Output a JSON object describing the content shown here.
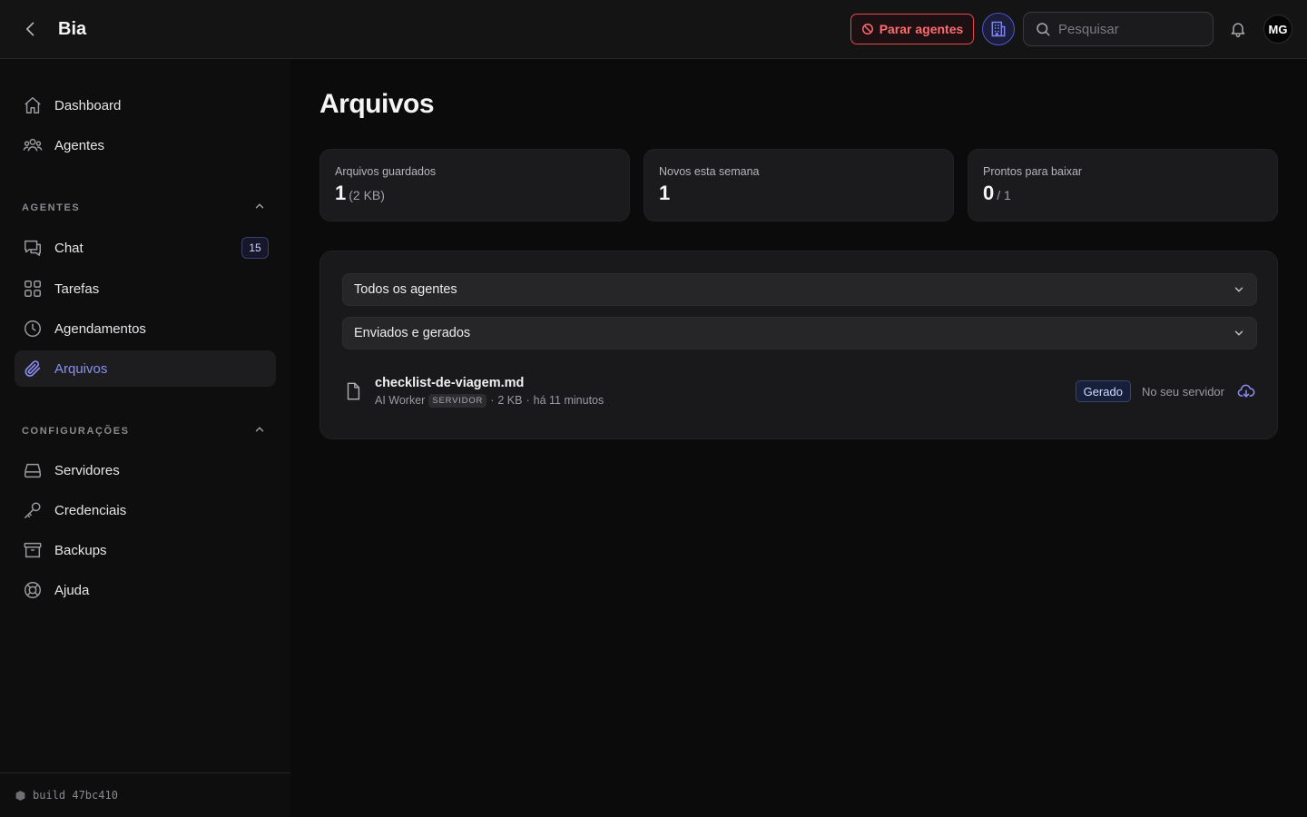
{
  "header": {
    "title": "Bia",
    "stop_label": "Parar agentes",
    "search_placeholder": "Pesquisar",
    "avatar_initials": "MG"
  },
  "sidebar": {
    "top_items": [
      {
        "label": "Dashboard",
        "icon": "home-icon"
      },
      {
        "label": "Agentes",
        "icon": "users-icon"
      }
    ],
    "sections": [
      {
        "title": "AGENTES",
        "items": [
          {
            "label": "Chat",
            "icon": "chat-icon",
            "badge": "15"
          },
          {
            "label": "Tarefas",
            "icon": "grid-icon"
          },
          {
            "label": "Agendamentos",
            "icon": "clock-icon"
          },
          {
            "label": "Arquivos",
            "icon": "paperclip-icon",
            "active": true
          }
        ]
      },
      {
        "title": "CONFIGURAÇÕES",
        "items": [
          {
            "label": "Servidores",
            "icon": "server-icon"
          },
          {
            "label": "Credenciais",
            "icon": "key-icon"
          },
          {
            "label": "Backups",
            "icon": "archive-icon"
          },
          {
            "label": "Ajuda",
            "icon": "lifebuoy-icon"
          }
        ]
      }
    ],
    "build_label": "build 47bc410"
  },
  "main": {
    "title": "Arquivos",
    "stats": [
      {
        "label": "Arquivos guardados",
        "value": "1",
        "sub": "(2 KB)"
      },
      {
        "label": "Novos esta semana",
        "value": "1",
        "sub": ""
      },
      {
        "label": "Prontos para baixar",
        "value": "0",
        "sub": "/ 1"
      }
    ],
    "filters": {
      "agent_select": "Todos os agentes",
      "type_select": "Enviados e gerados"
    },
    "files": [
      {
        "name": "checklist-de-viagem.md",
        "agent": "AI Worker",
        "agent_tag": "SERVIDOR",
        "size": "2 KB",
        "time": "há 11 minutos",
        "status": "Gerado",
        "location": "No seu servidor"
      }
    ]
  },
  "colors": {
    "accent": "#8b8ff5",
    "danger": "#e5484d",
    "background": "#0b0b0c"
  }
}
